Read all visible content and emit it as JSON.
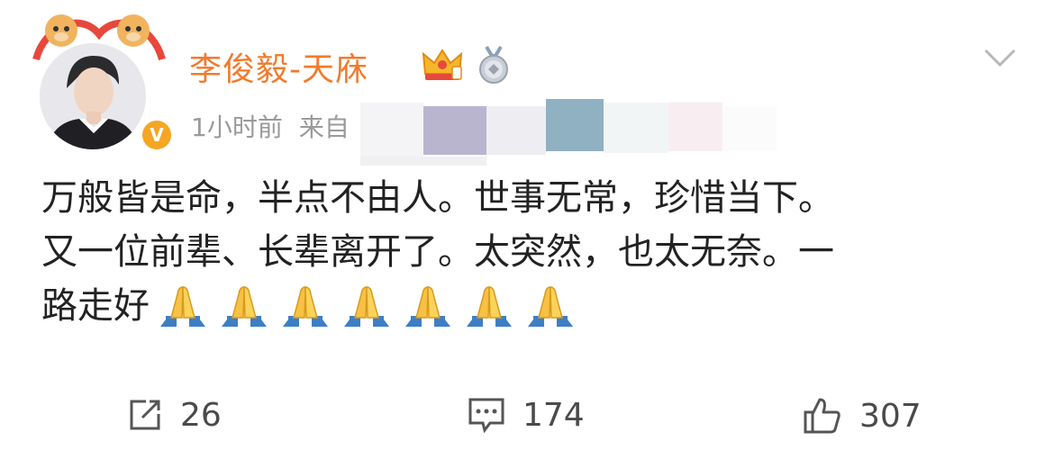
{
  "post": {
    "author": "李俊毅-天庥",
    "time": "1小时前",
    "source_prefix": "来自",
    "text_lines": [
      "万般皆是命，半点不由人。世事无常，珍惜当下。",
      "又一位前辈、长辈离开了。太突然，也太无奈。一",
      "路走好"
    ],
    "emoji": "folded-hands",
    "emoji_count": 7
  },
  "actions": {
    "share_count": "26",
    "comment_count": "174",
    "like_count": "307"
  },
  "colors": {
    "username": "#f37a2a",
    "meta": "#9a9a9a",
    "verify_badge": "#f5a623",
    "icon": "#555555"
  },
  "icons": [
    "v-verified-icon",
    "crown-badge-icon",
    "medal-badge-icon",
    "chevron-down-icon",
    "share-icon",
    "comment-icon",
    "like-icon",
    "folded-hands-icon"
  ]
}
